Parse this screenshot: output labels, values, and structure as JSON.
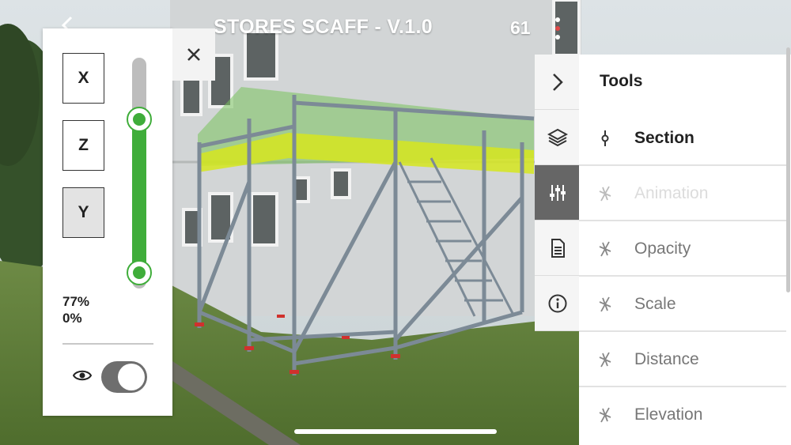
{
  "header": {
    "title": "STORES SCAFF - V.1.0",
    "count": "61"
  },
  "section_panel": {
    "axes": [
      {
        "label": "X",
        "active": false
      },
      {
        "label": "Z",
        "active": false
      },
      {
        "label": "Y",
        "active": true
      }
    ],
    "range_upper": "77%",
    "range_lower": "0%",
    "slider_upper_fraction": 0.77,
    "slider_lower_fraction": 0.0,
    "visibility_toggle_on": true
  },
  "tools_menu": {
    "title": "Tools",
    "items": [
      {
        "label": "Section",
        "state": "active",
        "icon": "section-pin-icon"
      },
      {
        "label": "Animation",
        "state": "disabled",
        "icon": "crossed-tool-icon"
      },
      {
        "label": "Opacity",
        "state": "normal",
        "icon": "crossed-tool-icon"
      },
      {
        "label": "Scale",
        "state": "normal",
        "icon": "crossed-tool-icon"
      },
      {
        "label": "Distance",
        "state": "normal",
        "icon": "crossed-tool-icon"
      },
      {
        "label": "Elevation",
        "state": "normal",
        "icon": "crossed-tool-icon"
      }
    ]
  },
  "side_tabs": [
    {
      "name": "collapse",
      "icon": "chevron-right-icon",
      "active": false
    },
    {
      "name": "layers",
      "icon": "layers-icon",
      "active": false
    },
    {
      "name": "tools",
      "icon": "sliders-icon",
      "active": true
    },
    {
      "name": "document",
      "icon": "document-icon",
      "active": false
    },
    {
      "name": "info",
      "icon": "info-icon",
      "active": false
    }
  ],
  "colors": {
    "accent_green": "#3fad3a",
    "active_tab": "#666666",
    "highlight_yellow": "#d6e61e"
  }
}
